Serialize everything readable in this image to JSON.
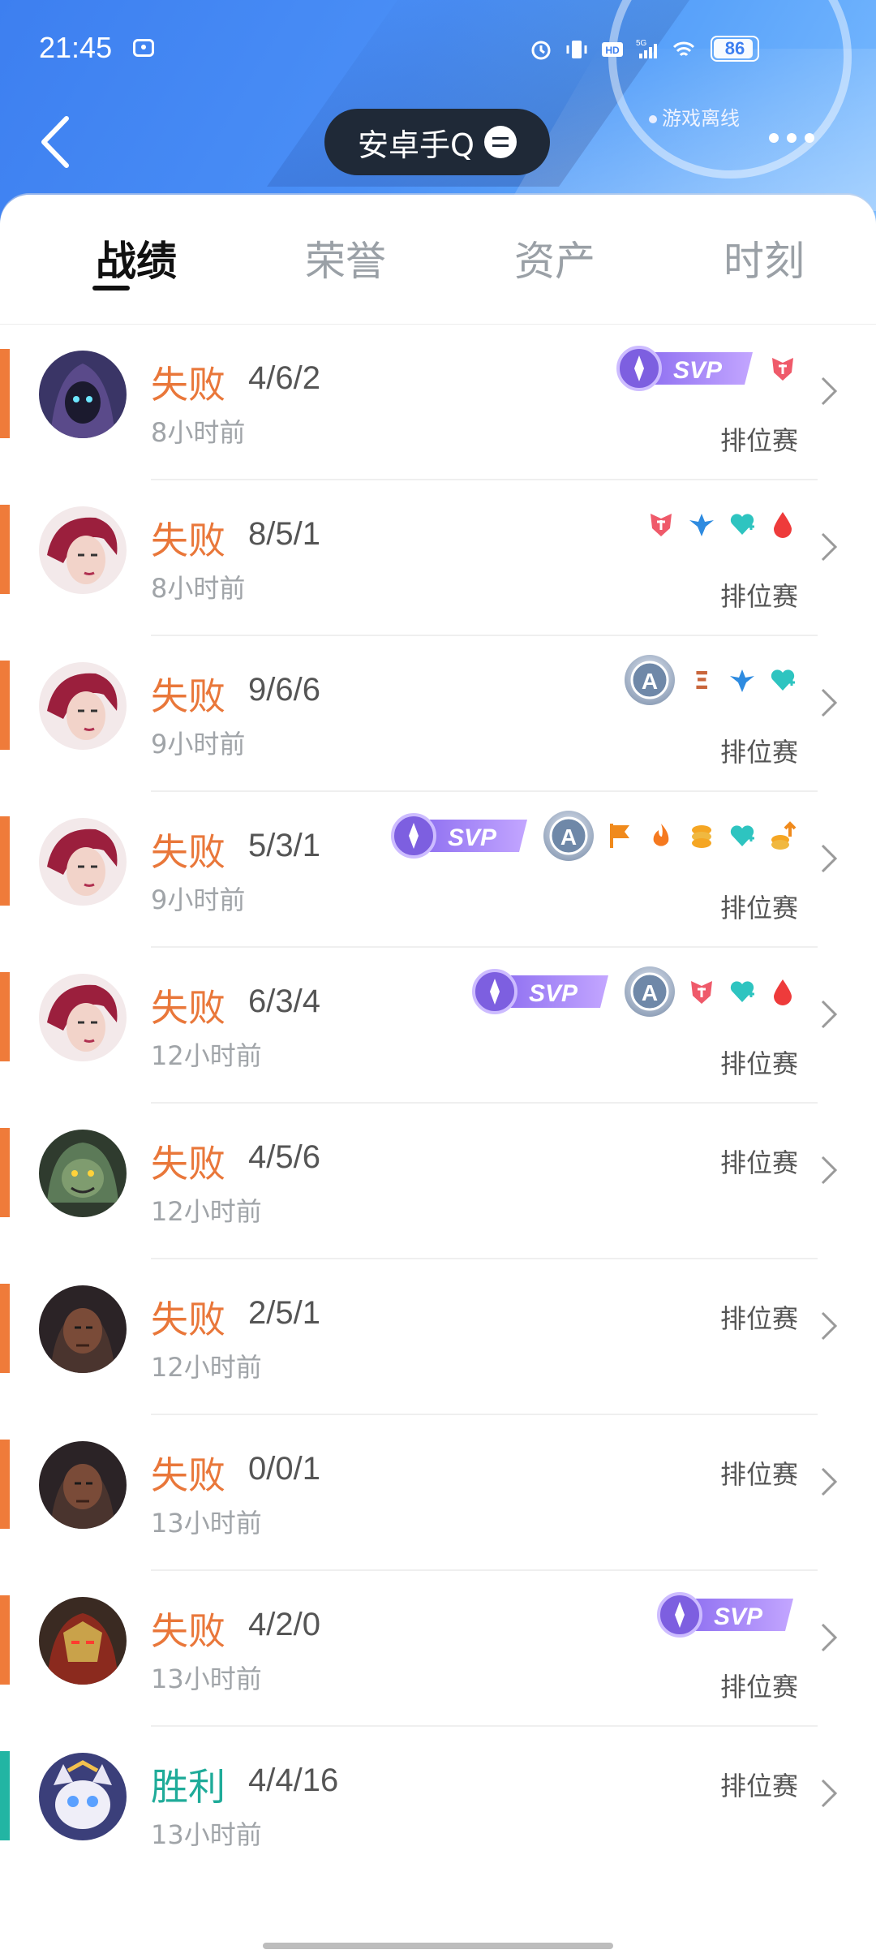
{
  "status_bar": {
    "time": "21:45",
    "battery": "86"
  },
  "header": {
    "account_name": "安卓手Q",
    "offline_label": "游戏离线"
  },
  "tabs": [
    {
      "label": "战绩",
      "active": true
    },
    {
      "label": "荣誉",
      "active": false
    },
    {
      "label": "资产",
      "active": false
    },
    {
      "label": "时刻",
      "active": false
    }
  ],
  "matches": [
    {
      "result": "失败",
      "outcome": "loss",
      "kda": "4/6/2",
      "ago": "8小时前",
      "mode": "排位赛",
      "hero_avatar": "hooded-assassin",
      "badges": [
        "svp",
        "mvp-crest-icon"
      ]
    },
    {
      "result": "失败",
      "outcome": "loss",
      "kda": "8/5/1",
      "ago": "8小时前",
      "mode": "排位赛",
      "hero_avatar": "red-hair-woman",
      "badges": [
        "mvp-crest-icon",
        "wings-icon",
        "heal-icon",
        "blood-icon"
      ]
    },
    {
      "result": "失败",
      "outcome": "loss",
      "kda": "9/6/6",
      "ago": "9小时前",
      "mode": "排位赛",
      "hero_avatar": "red-hair-woman",
      "badges": [
        "a-rank-medal",
        "triple-kill-icon",
        "wings-icon",
        "heal-icon"
      ]
    },
    {
      "result": "失败",
      "outcome": "loss",
      "kda": "5/3/1",
      "ago": "9小时前",
      "mode": "排位赛",
      "hero_avatar": "red-hair-woman",
      "badges": [
        "svp",
        "a-rank-medal",
        "flag-icon",
        "fire-icon",
        "coins-icon",
        "heal-icon",
        "gold-up-icon"
      ]
    },
    {
      "result": "失败",
      "outcome": "loss",
      "kda": "6/3/4",
      "ago": "12小时前",
      "mode": "排位赛",
      "hero_avatar": "red-hair-woman",
      "badges": [
        "svp",
        "a-rank-medal",
        "mvp-crest-icon",
        "heal-icon",
        "blood-icon"
      ]
    },
    {
      "result": "失败",
      "outcome": "loss",
      "kda": "4/5/6",
      "ago": "12小时前",
      "mode": "排位赛",
      "hero_avatar": "green-beast",
      "badges": []
    },
    {
      "result": "失败",
      "outcome": "loss",
      "kda": "2/5/1",
      "ago": "12小时前",
      "mode": "排位赛",
      "hero_avatar": "dark-skinned-warrior",
      "badges": []
    },
    {
      "result": "失败",
      "outcome": "loss",
      "kda": "0/0/1",
      "ago": "13小时前",
      "mode": "排位赛",
      "hero_avatar": "dark-skinned-warrior",
      "badges": []
    },
    {
      "result": "失败",
      "outcome": "loss",
      "kda": "4/2/0",
      "ago": "13小时前",
      "mode": "排位赛",
      "hero_avatar": "masked-red-warrior",
      "badges": [
        "svp"
      ]
    },
    {
      "result": "胜利",
      "outcome": "win",
      "kda": "4/4/16",
      "ago": "13小时前",
      "mode": "排位赛",
      "hero_avatar": "white-cat",
      "badges": []
    }
  ],
  "badge_labels": {
    "svp": "SVP",
    "a_rank": "A",
    "triple_kill": "Ξ"
  },
  "colors": {
    "loss": "#e9773a",
    "win": "#1fab99",
    "header_blue": "#3d7ff0"
  }
}
